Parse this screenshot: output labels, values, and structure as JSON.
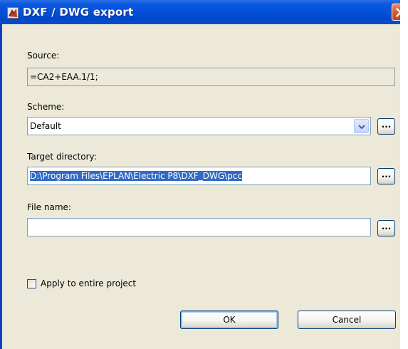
{
  "window": {
    "title": "DXF / DWG export",
    "icon": "eplan-app-icon",
    "close_icon": "close-icon"
  },
  "source": {
    "label": "Source:",
    "value": "=CA2+EAA.1/1;"
  },
  "scheme": {
    "label": "Scheme:",
    "selected": "Default",
    "browse_label": "..."
  },
  "target_directory": {
    "label": "Target directory:",
    "value": "D:\\Program Files\\EPLAN\\Electric P8\\DXF_DWG\\pcc",
    "browse_label": "..."
  },
  "file_name": {
    "label": "File name:",
    "value": "",
    "browse_label": "..."
  },
  "apply_entire_project": {
    "label": "Apply to entire project",
    "checked": false
  },
  "buttons": {
    "ok": "OK",
    "cancel": "Cancel"
  },
  "colors": {
    "titlebar": "#0451d8",
    "dialog_bg": "#ece9d8",
    "selection": "#316ac5",
    "close_button": "#d85a30"
  }
}
